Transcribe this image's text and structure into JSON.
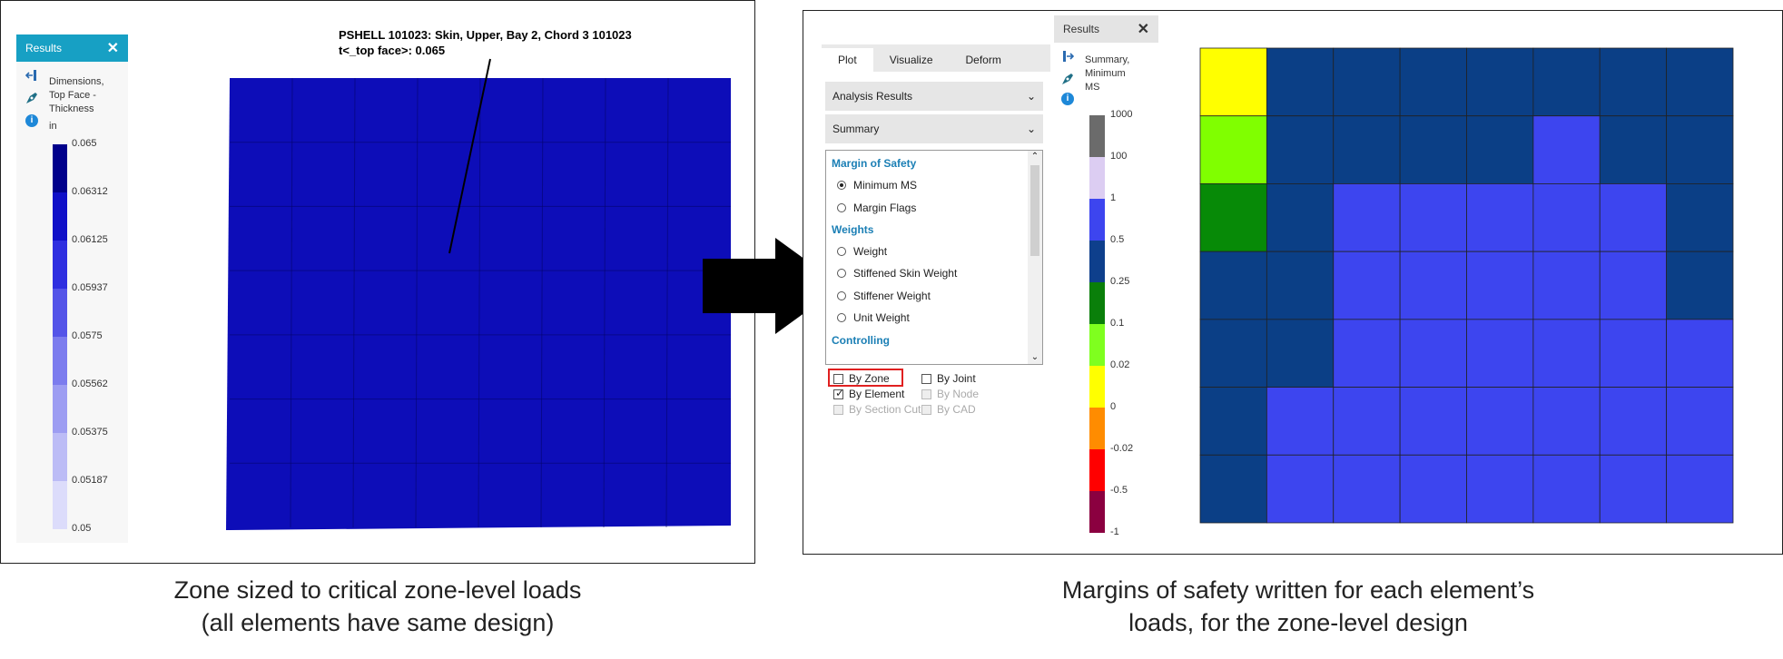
{
  "left": {
    "panel_title": "Results",
    "panel_close": "✕",
    "result_label": [
      "Dimensions,",
      "Top Face -",
      "Thickness"
    ],
    "unit": "in",
    "legend_values": [
      "0.065",
      "0.06312",
      "0.06125",
      "0.05937",
      "0.0575",
      "0.05562",
      "0.05375",
      "0.05187",
      "0.05"
    ],
    "legend_colors": [
      "#00008b",
      "#1010c8",
      "#2f2fe0",
      "#5454e8",
      "#7c7cee",
      "#9d9df2",
      "#bcbcf6",
      "#dcdcfb"
    ],
    "annotation_line1": "PSHELL 101023: Skin, Upper, Bay 2, Chord 3 101023",
    "annotation_line2": "t<_top face>: 0.065",
    "mesh_color": "#0d0db8"
  },
  "right": {
    "tabs": [
      "Plot",
      "Visualize",
      "Deform"
    ],
    "active_tab": 0,
    "dropdown1": "Analysis Results",
    "dropdown2": "Summary",
    "group_margin": "Margin of Safety",
    "opt_min_ms": "Minimum MS",
    "opt_margin_flags": "Margin Flags",
    "group_weights": "Weights",
    "opt_weight": "Weight",
    "opt_stiff_skin": "Stiffened Skin Weight",
    "opt_stiffener": "Stiffener Weight",
    "opt_unit_weight": "Unit Weight",
    "group_controlling": "Controlling",
    "cb_by_zone": "By Zone",
    "cb_by_joint": "By Joint",
    "cb_by_element": "By Element",
    "cb_by_node": "By Node",
    "cb_by_section": "By Section Cut",
    "cb_by_cad": "By CAD",
    "panel_title": "Results",
    "panel_close": "✕",
    "result_label": [
      "Summary,",
      "Minimum",
      "MS"
    ],
    "legend_values": [
      "1000",
      "100",
      "1",
      "0.5",
      "0.25",
      "0.1",
      "0.02",
      "0",
      "-0.02",
      "-0.5",
      "-1"
    ],
    "legend_colors": [
      "#6b6b6b",
      "#dccdf2",
      "#3d45ef",
      "#0e3f8c",
      "#0a7f0a",
      "#7fff1f",
      "#ffff00",
      "#ff8c00",
      "#ff0000",
      "#8b0040"
    ],
    "grid_colors": [
      [
        "yellow",
        "navy",
        "navy",
        "navy",
        "navy",
        "navy",
        "navy",
        "navy"
      ],
      [
        "lime",
        "navy",
        "navy",
        "navy",
        "navy",
        "blue",
        "navy",
        "navy"
      ],
      [
        "green",
        "navy",
        "blue",
        "blue",
        "blue",
        "blue",
        "blue",
        "navy"
      ],
      [
        "navy",
        "navy",
        "blue",
        "blue",
        "blue",
        "blue",
        "blue",
        "navy"
      ],
      [
        "navy",
        "navy",
        "blue",
        "blue",
        "blue",
        "blue",
        "blue",
        "blue"
      ],
      [
        "navy",
        "blue",
        "blue",
        "blue",
        "blue",
        "blue",
        "blue",
        "blue"
      ],
      [
        "navy",
        "blue",
        "blue",
        "blue",
        "blue",
        "blue",
        "blue",
        "blue"
      ]
    ],
    "palette": {
      "yellow": "#ffff00",
      "lime": "#80ff00",
      "green": "#078a07",
      "navy": "#0b3f86",
      "blue": "#3d45ef"
    }
  },
  "arrow_color": "#000000",
  "highlight_color": "#e02020",
  "caption_left": [
    "Zone sized to critical zone-level loads",
    "(all elements have same design)"
  ],
  "caption_right": [
    "Margins of safety written for each element’s",
    "loads, for the zone-level design"
  ]
}
